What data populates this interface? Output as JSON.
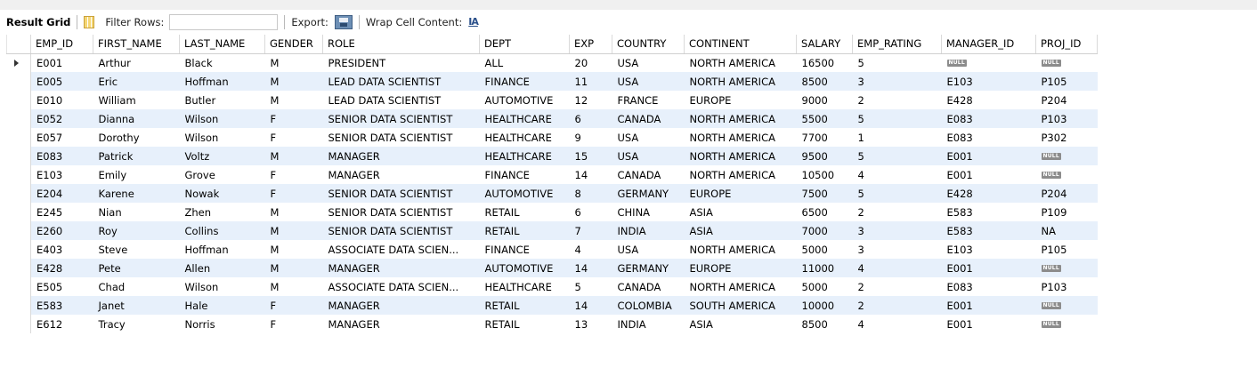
{
  "toolbar": {
    "result_grid_label": "Result Grid",
    "filter_rows_label": "Filter Rows:",
    "filter_rows_value": "",
    "export_label": "Export:",
    "wrap_label": "Wrap Cell Content:",
    "wrap_icon_glyph": "IA",
    "icons": [
      "grid-icon",
      "export-icon",
      "wrap-text-icon"
    ]
  },
  "null_text": "NULL",
  "columns": [
    "EMP_ID",
    "FIRST_NAME",
    "LAST_NAME",
    "GENDER",
    "ROLE",
    "DEPT",
    "EXP",
    "COUNTRY",
    "CONTINENT",
    "SALARY",
    "EMP_RATING",
    "MANAGER_ID",
    "PROJ_ID"
  ],
  "rows": [
    [
      "E001",
      "Arthur",
      "Black",
      "M",
      "PRESIDENT",
      "ALL",
      "20",
      "USA",
      "NORTH AMERICA",
      "16500",
      "5",
      null,
      null
    ],
    [
      "E005",
      "Eric",
      "Hoffman",
      "M",
      "LEAD DATA SCIENTIST",
      "FINANCE",
      "11",
      "USA",
      "NORTH AMERICA",
      "8500",
      "3",
      "E103",
      "P105"
    ],
    [
      "E010",
      "William",
      "Butler",
      "M",
      "LEAD DATA SCIENTIST",
      "AUTOMOTIVE",
      "12",
      "FRANCE",
      "EUROPE",
      "9000",
      "2",
      "E428",
      "P204"
    ],
    [
      "E052",
      "Dianna",
      "Wilson",
      "F",
      "SENIOR DATA SCIENTIST",
      "HEALTHCARE",
      "6",
      "CANADA",
      "NORTH AMERICA",
      "5500",
      "5",
      "E083",
      "P103"
    ],
    [
      "E057",
      "Dorothy",
      "Wilson",
      "F",
      "SENIOR DATA SCIENTIST",
      "HEALTHCARE",
      "9",
      "USA",
      "NORTH AMERICA",
      "7700",
      "1",
      "E083",
      "P302"
    ],
    [
      "E083",
      "Patrick",
      "Voltz",
      "M",
      "MANAGER",
      "HEALTHCARE",
      "15",
      "USA",
      "NORTH AMERICA",
      "9500",
      "5",
      "E001",
      null
    ],
    [
      "E103",
      "Emily",
      "Grove",
      "F",
      "MANAGER",
      "FINANCE",
      "14",
      "CANADA",
      "NORTH AMERICA",
      "10500",
      "4",
      "E001",
      null
    ],
    [
      "E204",
      "Karene",
      "Nowak",
      "F",
      "SENIOR DATA SCIENTIST",
      "AUTOMOTIVE",
      "8",
      "GERMANY",
      "EUROPE",
      "7500",
      "5",
      "E428",
      "P204"
    ],
    [
      "E245",
      "Nian",
      "Zhen",
      "M",
      "SENIOR DATA SCIENTIST",
      "RETAIL",
      "6",
      "CHINA",
      "ASIA",
      "6500",
      "2",
      "E583",
      "P109"
    ],
    [
      "E260",
      "Roy",
      "Collins",
      "M",
      "SENIOR DATA SCIENTIST",
      "RETAIL",
      "7",
      "INDIA",
      "ASIA",
      "7000",
      "3",
      "E583",
      "NA"
    ],
    [
      "E403",
      "Steve",
      "Hoffman",
      "M",
      "ASSOCIATE DATA SCIEN...",
      "FINANCE",
      "4",
      "USA",
      "NORTH AMERICA",
      "5000",
      "3",
      "E103",
      "P105"
    ],
    [
      "E428",
      "Pete",
      "Allen",
      "M",
      "MANAGER",
      "AUTOMOTIVE",
      "14",
      "GERMANY",
      "EUROPE",
      "11000",
      "4",
      "E001",
      null
    ],
    [
      "E505",
      "Chad",
      "Wilson",
      "M",
      "ASSOCIATE DATA SCIEN...",
      "HEALTHCARE",
      "5",
      "CANADA",
      "NORTH AMERICA",
      "5000",
      "2",
      "E083",
      "P103"
    ],
    [
      "E583",
      "Janet",
      "Hale",
      "F",
      "MANAGER",
      "RETAIL",
      "14",
      "COLOMBIA",
      "SOUTH AMERICA",
      "10000",
      "2",
      "E001",
      null
    ],
    [
      "E612",
      "Tracy",
      "Norris",
      "F",
      "MANAGER",
      "RETAIL",
      "13",
      "INDIA",
      "ASIA",
      "8500",
      "4",
      "E001",
      null
    ]
  ],
  "current_row_index": 0,
  "colors": {
    "alt_row": "#e7f0fb",
    "null_badge": "#8c8c8c",
    "toolbar_bg": "#ffffff",
    "top_strip": "#f0f0f0"
  }
}
